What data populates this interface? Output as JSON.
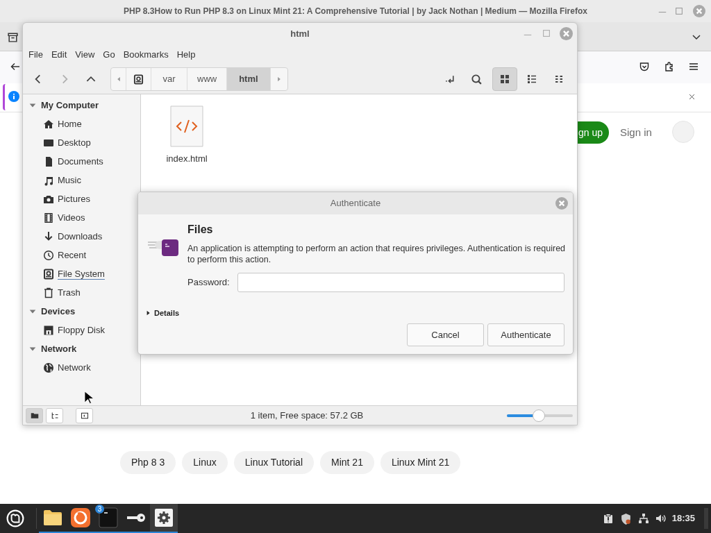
{
  "browser": {
    "title": "PHP 8.3How to Run PHP 8.3 on Linux Mint 21: A Comprehensive Tutorial | by Jack Nothan | Medium — Mozilla Firefox",
    "sign_up": "gn up",
    "sign_in": "Sign in",
    "tags": [
      "Php 8 3",
      "Linux",
      "Linux Tutorial",
      "Mint 21",
      "Linux Mint 21"
    ]
  },
  "file_manager": {
    "title": "html",
    "menu": [
      "File",
      "Edit",
      "View",
      "Go",
      "Bookmarks",
      "Help"
    ],
    "nav_buttons": [
      {
        "kind": "back",
        "disabled": false
      },
      {
        "kind": "forward",
        "disabled": true
      },
      {
        "kind": "up",
        "disabled": false
      }
    ],
    "breadcrumb": [
      {
        "label": "var",
        "selected": false
      },
      {
        "label": "www",
        "selected": false
      },
      {
        "label": "html",
        "selected": true
      }
    ],
    "view_modes": [
      {
        "kind": "icons",
        "selected": true
      },
      {
        "kind": "list",
        "selected": false
      },
      {
        "kind": "compact",
        "selected": false
      }
    ],
    "sidebar": [
      {
        "label": "My Computer",
        "expanded": true,
        "children": [
          {
            "label": "Home",
            "kind": "home",
            "focused": false
          },
          {
            "label": "Desktop",
            "kind": "desktop",
            "focused": false
          },
          {
            "label": "Documents",
            "kind": "documents",
            "focused": false
          },
          {
            "label": "Music",
            "kind": "music",
            "focused": false
          },
          {
            "label": "Pictures",
            "kind": "pictures",
            "focused": false
          },
          {
            "label": "Videos",
            "kind": "videos",
            "focused": false
          },
          {
            "label": "Downloads",
            "kind": "downloads",
            "focused": false
          },
          {
            "label": "Recent",
            "kind": "recent",
            "focused": false
          },
          {
            "label": "File System",
            "kind": "filesystem",
            "focused": true
          },
          {
            "label": "Trash",
            "kind": "trash",
            "focused": false
          }
        ]
      },
      {
        "label": "Devices",
        "expanded": true,
        "children": [
          {
            "label": "Floppy Disk",
            "kind": "floppy",
            "focused": false
          }
        ]
      },
      {
        "label": "Network",
        "expanded": true,
        "children": [
          {
            "label": "Network",
            "kind": "network",
            "focused": false
          }
        ]
      }
    ],
    "files": [
      {
        "name": "index.html",
        "kind": "html"
      }
    ],
    "pane_buttons": [
      {
        "kind": "places",
        "selected": true
      },
      {
        "kind": "tree",
        "selected": false
      }
    ],
    "status": "1 item, Free space: 57.2 GB",
    "zoom": {
      "level": 0.48
    }
  },
  "auth_dialog": {
    "title": "Authenticate",
    "heading": "Files",
    "message": "An application is attempting to perform an action that requires privileges. Authentication is required to perform this action.",
    "password_label": "Password:",
    "details": {
      "label": "Details",
      "expanded": false
    },
    "buttons": [
      "Cancel",
      "Authenticate"
    ]
  },
  "taskbar": {
    "apps": [
      {
        "kind": "files",
        "running": true,
        "selected": false
      },
      {
        "kind": "firefox",
        "running": true,
        "selected": false
      },
      {
        "kind": "terminal",
        "running": true,
        "selected": false,
        "badge": "3"
      },
      {
        "kind": "passwords",
        "running": true,
        "selected": false
      },
      {
        "kind": "settings",
        "running": true,
        "selected": true
      }
    ],
    "clock": "18:35"
  }
}
